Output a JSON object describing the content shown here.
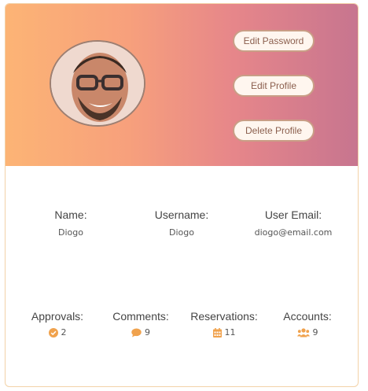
{
  "colors": {
    "accent": "#f0a24d",
    "banner_start": "#fcb475",
    "banner_end": "#c7758f"
  },
  "actions": {
    "edit_password": "Edit Password",
    "edit_profile": "Edit Profile",
    "delete_profile": "Delete Profile"
  },
  "profile": {
    "avatar_icon": "user-avatar",
    "fields": [
      {
        "label": "Name:",
        "value": "Diogo"
      },
      {
        "label": "Username:",
        "value": "Diogo"
      },
      {
        "label": "User Email:",
        "value": "diogo@email.com"
      }
    ]
  },
  "stats": [
    {
      "label": "Approvals:",
      "value": "2",
      "icon": "check-circle-icon"
    },
    {
      "label": "Comments:",
      "value": "9",
      "icon": "comment-icon"
    },
    {
      "label": "Reservations:",
      "value": "11",
      "icon": "calendar-icon"
    },
    {
      "label": "Accounts:",
      "value": "9",
      "icon": "users-icon"
    }
  ]
}
